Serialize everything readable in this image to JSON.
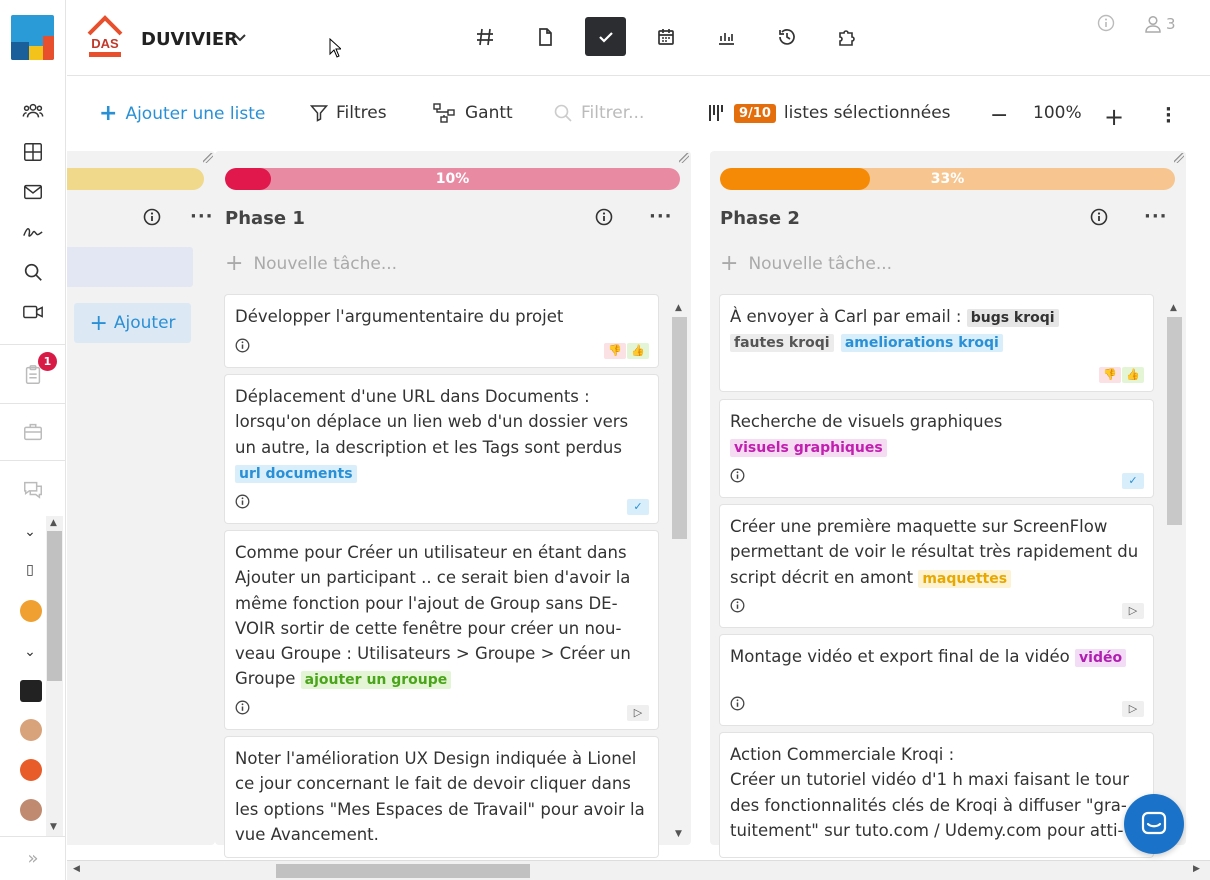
{
  "header": {
    "company_name": "DUVIVIER",
    "company_logo_text": "DAS",
    "user_count": "3",
    "tools": [
      "hash-icon",
      "document-icon",
      "check-icon",
      "calendar-icon",
      "chart-icon",
      "history-icon",
      "puzzle-icon"
    ]
  },
  "sidebar": {
    "notification_count": "1",
    "icons": [
      "users-icon",
      "grid-icon",
      "mail-icon",
      "signature-icon",
      "search-icon",
      "video-icon",
      "clipboard-icon",
      "briefcase-icon",
      "chat-icon",
      "expand-icon"
    ]
  },
  "toolbar": {
    "add_list_label": "Ajouter une liste",
    "filters_label": "Filtres",
    "gantt_label": "Gantt",
    "filter_placeholder": "Filtrer...",
    "selected_count": "9/10",
    "selected_label": "listes sélectionnées",
    "zoom_level": "100%"
  },
  "columns": [
    {
      "title": "",
      "progress_color": "#f0d98a",
      "add_label": "Ajouter"
    },
    {
      "title": "Phase 1",
      "progress_text": "10%",
      "progress": 0.1,
      "progress_color": "#e0184c",
      "progress_bg": "#e98aa3",
      "new_task_placeholder": "Nouvelle tâche...",
      "cards": [
        {
          "text": "Développer l'argumententaire du projet",
          "tags": [],
          "status": "thumbs"
        },
        {
          "text": "Déplacement d'une URL dans Documents : lorsqu'on déplace un lien web d'un dossier vers un autre, la description et les Tags sont perdus",
          "tags": [
            {
              "label": "url documents",
              "color": "#2a90d6",
              "bg": "#d9eefb"
            }
          ],
          "status": "check"
        },
        {
          "text": "Comme pour Créer un utilisateur en étant dans Ajouter un participant .. ce serait bien d'avoir la même fonction pour l'ajout de Group sans DE-VOIR sortir de cette fenêtre pour créer un nou-veau Groupe :  Utilisateurs > Groupe > Créer un Groupe",
          "tags": [
            {
              "label": "ajouter un groupe",
              "color": "#4aa51a",
              "bg": "#e4f5d6"
            }
          ],
          "status": "play"
        },
        {
          "text": "Noter l'amélioration UX Design indiquée à Lionel ce jour concernant le fait de devoir cliquer dans les options \"Mes Espaces de Travail\" pour avoir la vue Avancement.",
          "tags": [],
          "status": ""
        }
      ]
    },
    {
      "title": "Phase 2",
      "progress_text": "33%",
      "progress": 0.33,
      "progress_color": "#f58a07",
      "progress_bg": "#f7c690",
      "new_task_placeholder": "Nouvelle tâche...",
      "cards": [
        {
          "text": "À envoyer à Carl par email :",
          "tags": [
            {
              "label": "bugs kroqi",
              "color": "#333",
              "bg": "#e6e6e6"
            },
            {
              "label": "fautes kroqi",
              "color": "#555",
              "bg": "#ececec"
            },
            {
              "label": "ameliorations kroqi",
              "color": "#2a90d6",
              "bg": "#d9eefb"
            }
          ],
          "status": "thumbs"
        },
        {
          "text": "Recherche de visuels graphiques",
          "tags": [
            {
              "label": "visuels graphiques",
              "color": "#c21fb0",
              "bg": "#f6dcf2"
            }
          ],
          "status": "check"
        },
        {
          "text": "Créer une première maquette sur ScreenFlow permettant  de voir le résultat très rapidement du script décrit en amont",
          "tags": [
            {
              "label": "maquettes",
              "color": "#e8a800",
              "bg": "#fdf3d2"
            }
          ],
          "status": "play"
        },
        {
          "text": "Montage vidéo et export final de la vidéo",
          "tags": [
            {
              "label": "vidéo",
              "color": "#b01fb0",
              "bg": "#f3dcf6"
            }
          ],
          "status": "play"
        },
        {
          "text_lines": [
            "Action Commerciale Kroqi :",
            "Créer un tutoriel vidéo d'1 h maxi faisant le tour des fonctionnalités clés de Kroqi à diffuser \"gra-tuitement\" sur tuto.com / Udemy.com pour atti-"
          ],
          "tags": [],
          "status": ""
        }
      ]
    }
  ]
}
